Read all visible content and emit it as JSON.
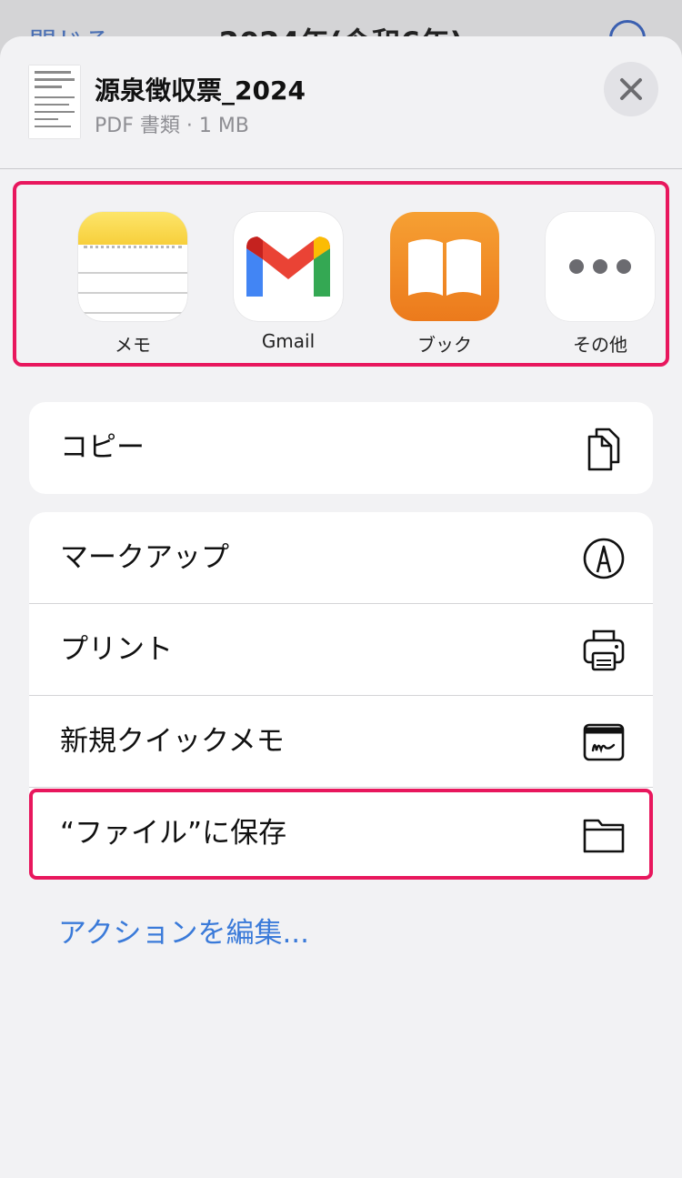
{
  "background": {
    "close_label": "閉じる",
    "title": "2024年(令和6年)"
  },
  "document": {
    "title": "源泉徴収票_2024",
    "subtitle": "PDF 書類 · 1 MB"
  },
  "apps": [
    {
      "label": "メモ",
      "icon": "notes-icon"
    },
    {
      "label": "Gmail",
      "icon": "gmail-icon"
    },
    {
      "label": "ブック",
      "icon": "books-icon"
    },
    {
      "label": "その他",
      "icon": "more-icon"
    }
  ],
  "actions": {
    "copy": "コピー",
    "markup": "マークアップ",
    "print": "プリント",
    "quick_note": "新規クイックメモ",
    "save_to_files": "“ファイル”に保存"
  },
  "edit_actions": "アクションを編集...",
  "colors": {
    "highlight": "#e8175d",
    "link": "#3a7ad9"
  }
}
